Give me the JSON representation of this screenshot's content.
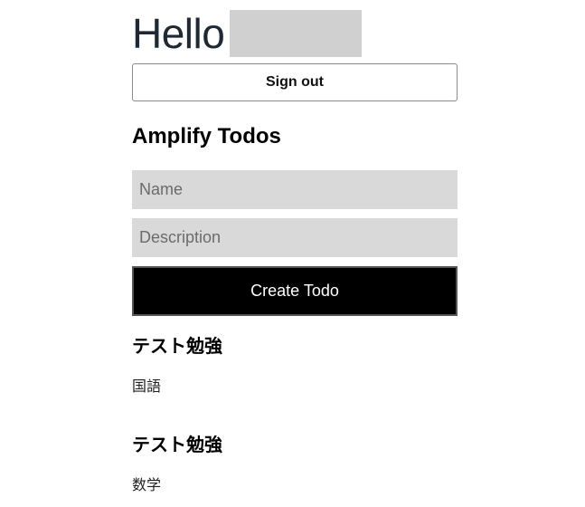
{
  "header": {
    "greeting": "Hello",
    "sign_out_label": "Sign out"
  },
  "app": {
    "title": "Amplify Todos"
  },
  "form": {
    "name_placeholder": "Name",
    "description_placeholder": "Description",
    "create_label": "Create Todo"
  },
  "todos": [
    {
      "name": "テスト勉強",
      "description": "国語"
    },
    {
      "name": "テスト勉強",
      "description": "数学"
    }
  ],
  "colors": {
    "create_button_bg": "#000000",
    "input_bg": "#d9d9d9",
    "redaction": "#d0d0d0"
  }
}
